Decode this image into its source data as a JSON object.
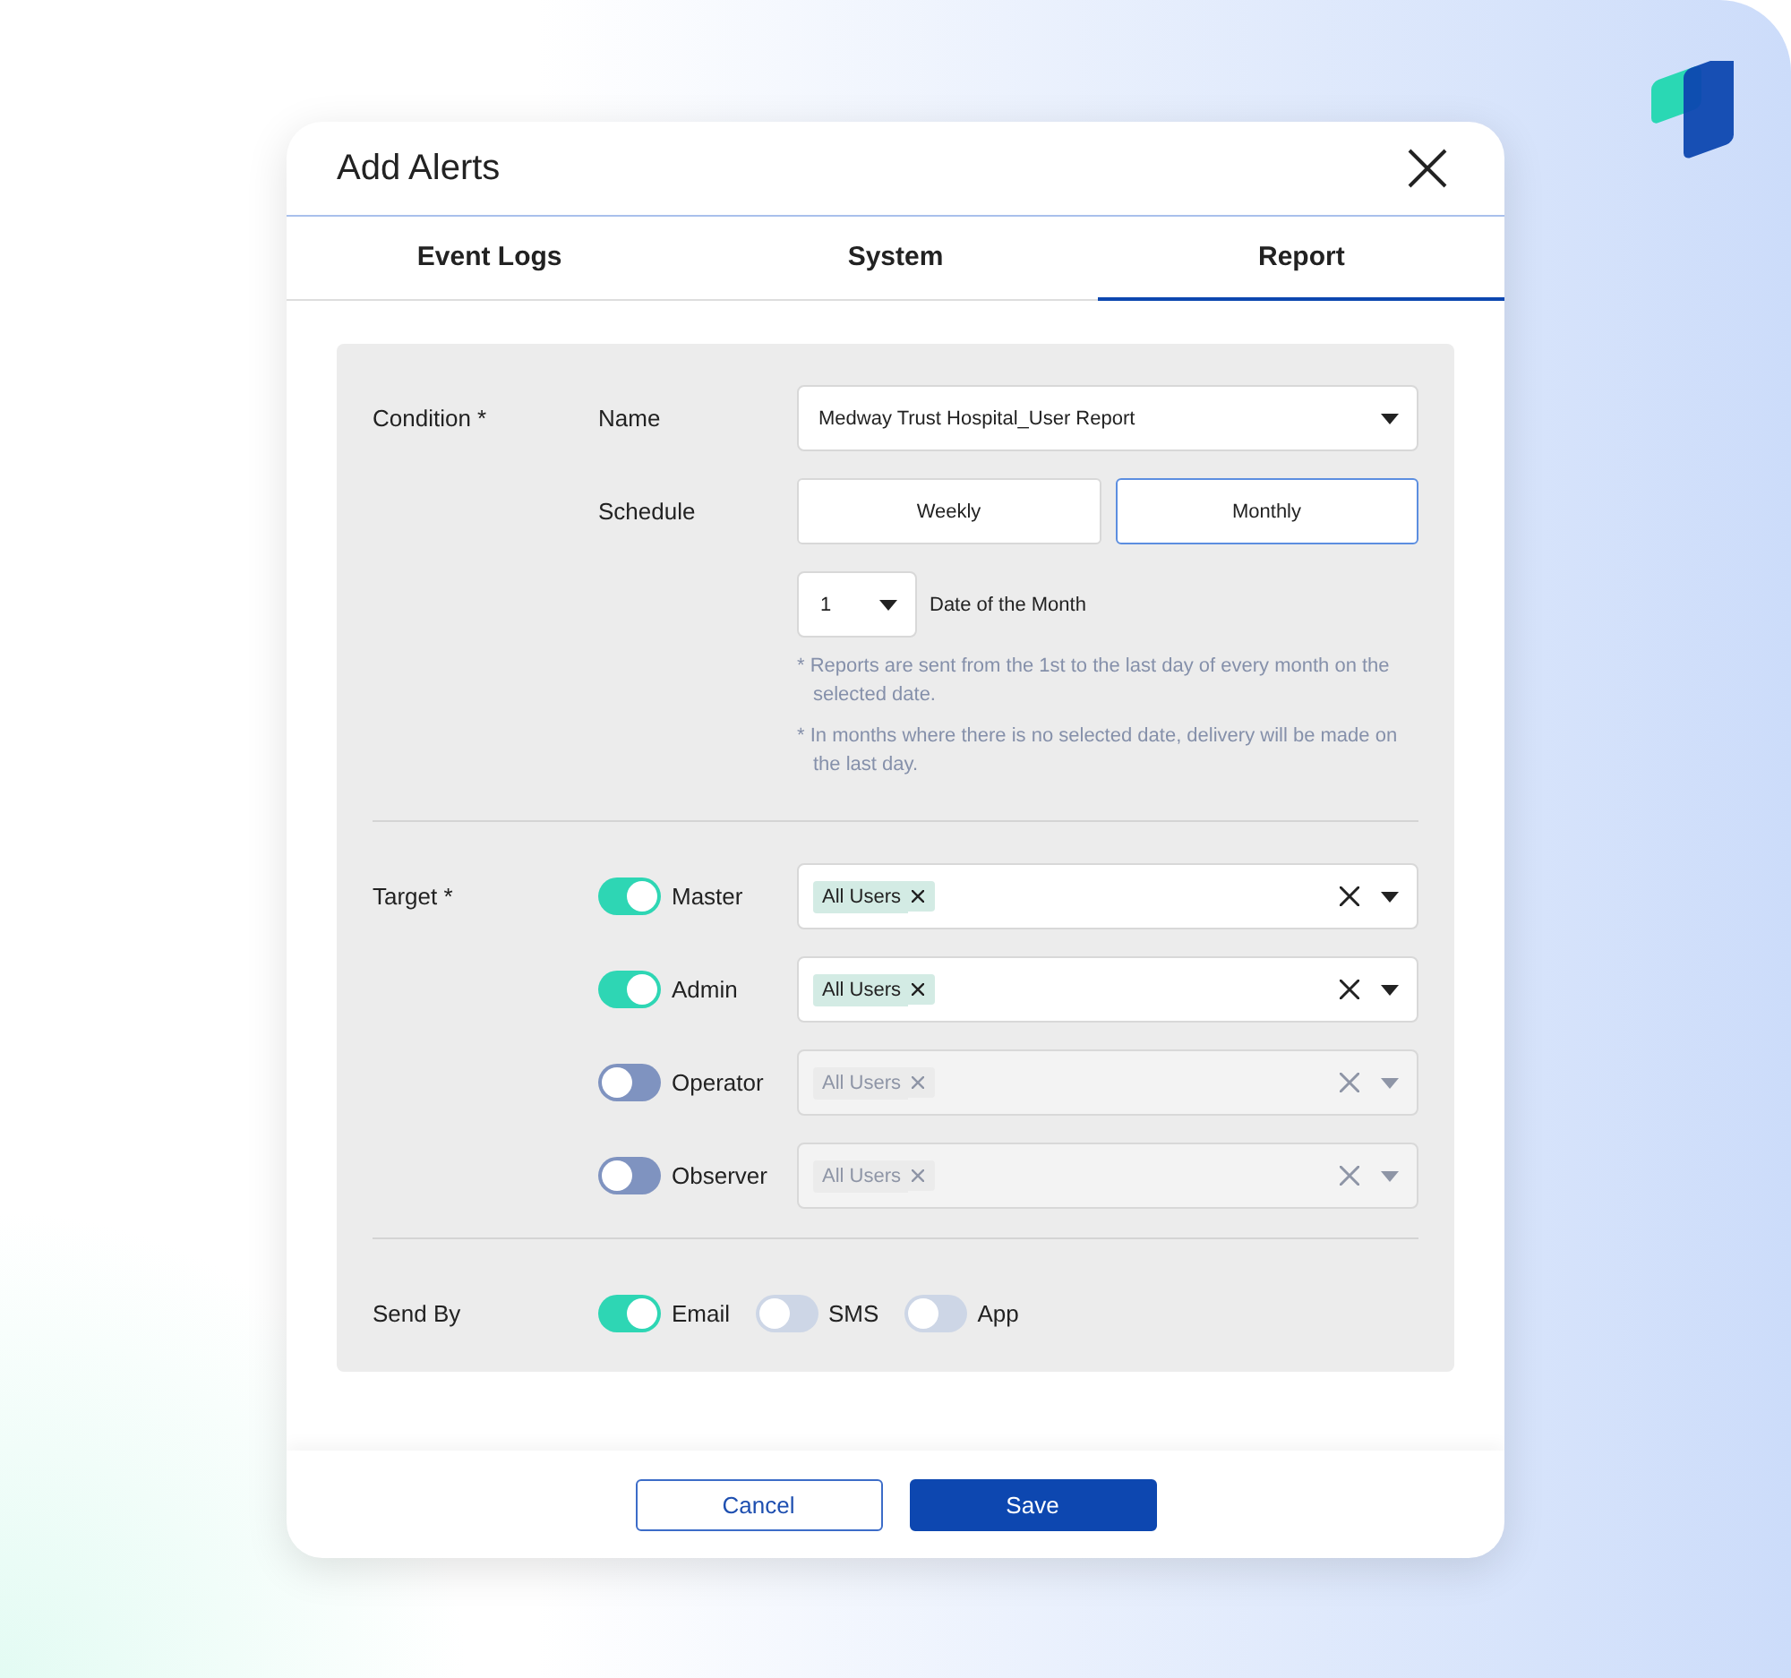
{
  "window": {
    "title": "Add Alerts"
  },
  "tabs": [
    {
      "label": "Event Logs",
      "selected": false
    },
    {
      "label": "System",
      "selected": false
    },
    {
      "label": "Report",
      "selected": true
    }
  ],
  "condition": {
    "label": "Condition *",
    "name": {
      "label": "Name",
      "value": "Medway Trust Hospital_User Report"
    },
    "schedule": {
      "label": "Schedule",
      "options": [
        {
          "label": "Weekly",
          "selected": false
        },
        {
          "label": "Monthly",
          "selected": true
        }
      ]
    },
    "date": {
      "value": "1",
      "label": "Date of the Month"
    },
    "notes": [
      "* Reports are sent from the 1st to the last day of every month on the selected date.",
      "* In months where there is no selected date, delivery will be made on the last day."
    ]
  },
  "target": {
    "label": "Target *",
    "roles": [
      {
        "name": "Master",
        "on": true,
        "tag": "All Users"
      },
      {
        "name": "Admin",
        "on": true,
        "tag": "All Users"
      },
      {
        "name": "Operator",
        "on": false,
        "tag": "All Users"
      },
      {
        "name": "Observer",
        "on": false,
        "tag": "All Users"
      }
    ]
  },
  "send_by": {
    "label": "Send By",
    "channels": [
      {
        "name": "Email",
        "on": true
      },
      {
        "name": "SMS",
        "on": false
      },
      {
        "name": "App",
        "on": false
      }
    ]
  },
  "buttons": {
    "cancel": "Cancel",
    "save": "Save"
  }
}
